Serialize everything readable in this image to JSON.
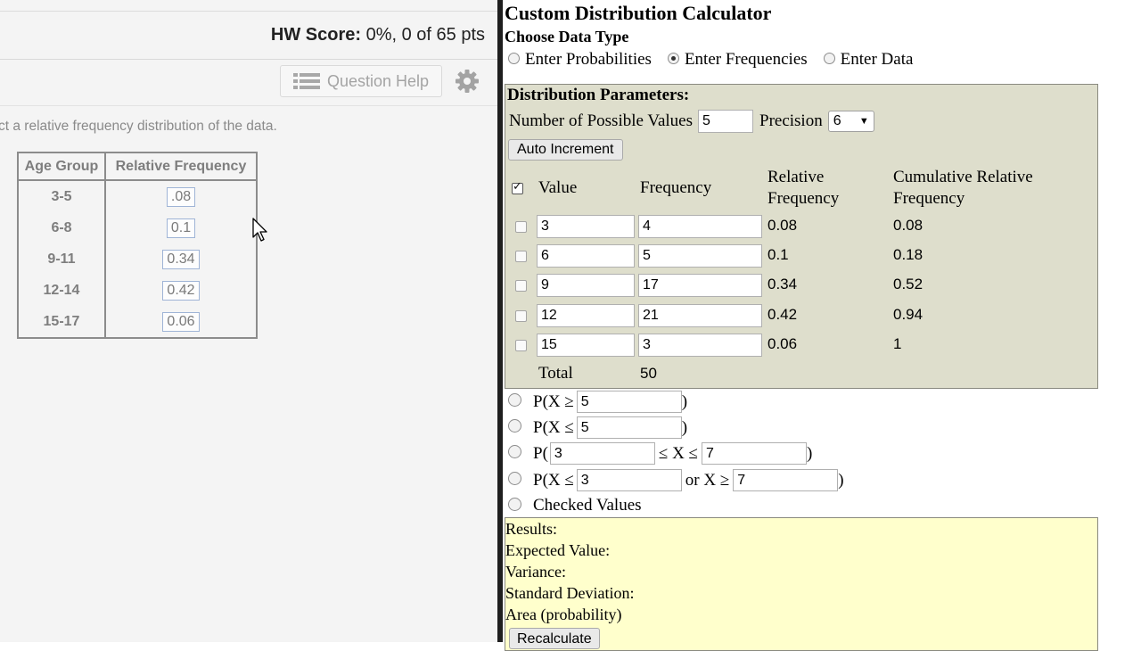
{
  "left": {
    "hw_score_label": "HW Score:",
    "hw_score_value": "0%, 0 of 65 pts",
    "question_help_label": "Question Help",
    "instruction": "ct a relative frequency distribution of the data.",
    "table": {
      "headers": [
        "Age Group",
        "Relative Frequency"
      ],
      "rows": [
        {
          "group": "3-5",
          "rel": ".08"
        },
        {
          "group": "6-8",
          "rel": "0.1"
        },
        {
          "group": "9-11",
          "rel": "0.34"
        },
        {
          "group": "12-14",
          "rel": "0.42"
        },
        {
          "group": "15-17",
          "rel": "0.06"
        }
      ]
    }
  },
  "calc": {
    "title": "Custom Distribution Calculator",
    "choose_label": "Choose Data Type",
    "data_types": [
      {
        "label": "Enter Probabilities",
        "selected": false
      },
      {
        "label": "Enter Frequencies",
        "selected": true
      },
      {
        "label": "Enter Data",
        "selected": false
      }
    ],
    "params_title": "Distribution Parameters:",
    "num_values_label": "Number of Possible Values",
    "num_values": "5",
    "precision_label": "Precision",
    "precision": "6",
    "auto_increment_label": "Auto Increment",
    "headers": {
      "value": "Value",
      "frequency": "Frequency",
      "rel_1": "Relative",
      "rel_2": "Frequency",
      "cum_1": "Cumulative Relative",
      "cum_2": "Frequency"
    },
    "rows": [
      {
        "value": "3",
        "freq": "4",
        "rel": "0.08",
        "cum": "0.08"
      },
      {
        "value": "6",
        "freq": "5",
        "rel": "0.1",
        "cum": "0.18"
      },
      {
        "value": "9",
        "freq": "17",
        "rel": "0.34",
        "cum": "0.52"
      },
      {
        "value": "12",
        "freq": "21",
        "rel": "0.42",
        "cum": "0.94"
      },
      {
        "value": "15",
        "freq": "3",
        "rel": "0.06",
        "cum": "1"
      }
    ],
    "total_label": "Total",
    "total_value": "50",
    "prob_options": {
      "ge_prefix": "P(X ≥",
      "ge_value": "5",
      "le_prefix": "P(X ≤",
      "le_value": "5",
      "between_prefix": "P(",
      "between_low": "3",
      "between_mid": "≤ X ≤",
      "between_high": "7",
      "or_prefix": "P(X ≤",
      "or_low": "3",
      "or_mid": "or X ≥",
      "or_high": "7",
      "close_paren": ")",
      "checked_values_label": "Checked Values"
    },
    "results": {
      "results_label": "Results:",
      "expected_label": "Expected Value:",
      "variance_label": "Variance:",
      "sd_label": "Standard Deviation:",
      "area_label": "Area (probability)",
      "recalc_label": "Recalculate"
    }
  }
}
